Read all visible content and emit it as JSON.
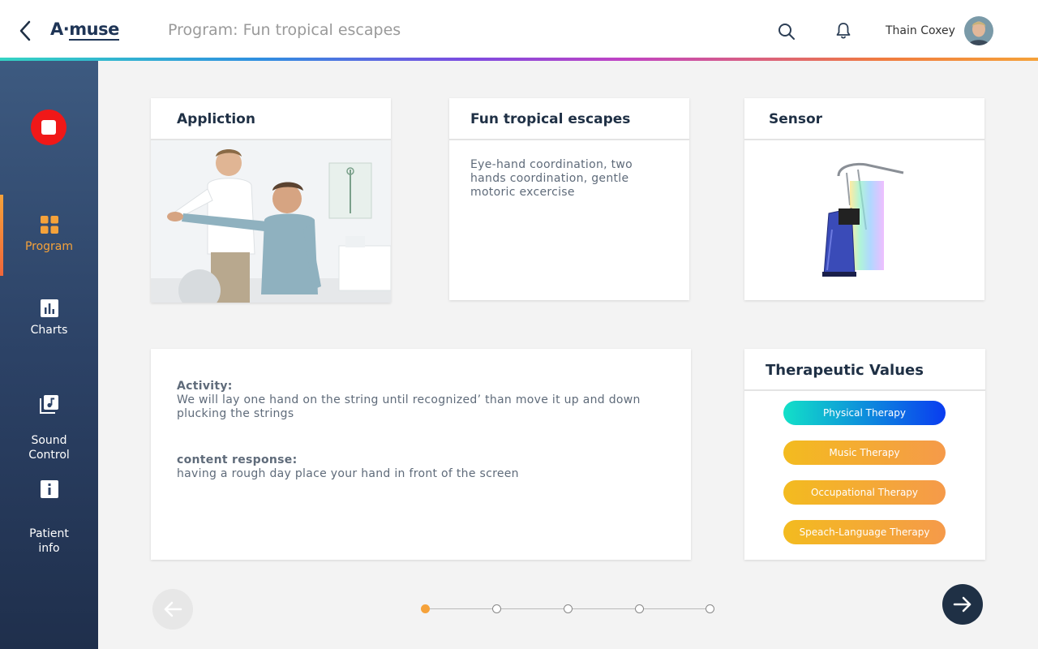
{
  "header": {
    "logo": {
      "a": "A",
      "dot": "·",
      "rest": "muse"
    },
    "title": "Program: Fun tropical escapes",
    "user_name": "Thain Coxey"
  },
  "sidebar": {
    "items": [
      {
        "label": "Program",
        "icon": "grid-icon",
        "active": true
      },
      {
        "label": "Charts",
        "icon": "bar-chart-icon"
      },
      {
        "label": "Sound\nControl",
        "icon": "music-library-icon"
      },
      {
        "label": "Patient\ninfo",
        "icon": "info-icon"
      }
    ]
  },
  "cards": {
    "application": {
      "title": "Appliction"
    },
    "program": {
      "title": "Fun tropical escapes",
      "description": "Eye-hand coordination, two hands coordination, gentle motoric excercise"
    },
    "sensor": {
      "title": "Sensor"
    },
    "activity": {
      "activity_label": "Activity:",
      "activity_text": "We will lay one hand on the string until recognized’ than move it up and down plucking the strings",
      "response_label": "content response:",
      "response_text": "having a rough day place your hand in front of the screen"
    },
    "therapeutic": {
      "title": "Therapeutic Values",
      "items": [
        "Physical Therapy",
        "Music Therapy",
        "Occupational Therapy",
        "Speach-Language Therapy"
      ]
    }
  },
  "stepper": {
    "total": 5,
    "current": 1
  },
  "colors": {
    "accent": "#f5a23a",
    "navy": "#1f3045",
    "stop": "#f01818"
  }
}
